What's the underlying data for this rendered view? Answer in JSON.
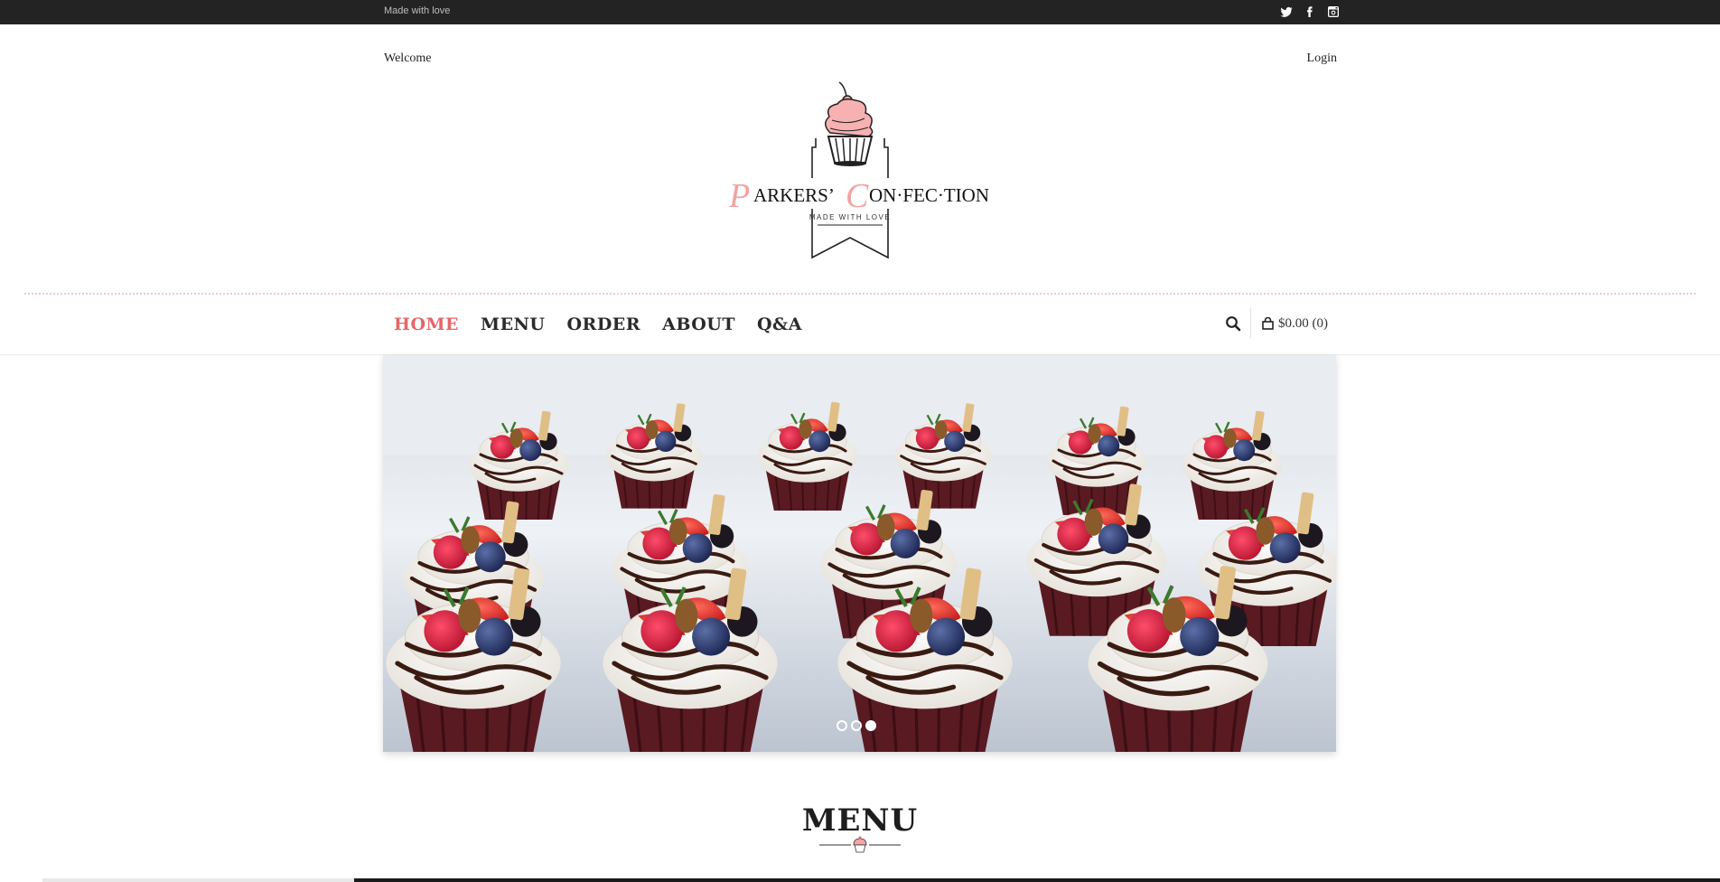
{
  "topbar": {
    "tagline": "Made with love",
    "social": [
      {
        "name": "twitter-icon"
      },
      {
        "name": "facebook-icon"
      },
      {
        "name": "instagram-icon"
      }
    ]
  },
  "header": {
    "welcome": "Welcome",
    "login": "Login",
    "logo": {
      "brand": "PARKERS' CON·FEC·TION",
      "tagline": "MADE WITH LOVE"
    }
  },
  "nav": {
    "items": [
      {
        "label": "HOME",
        "active": true
      },
      {
        "label": "MENU",
        "active": false
      },
      {
        "label": "ORDER",
        "active": false
      },
      {
        "label": "ABOUT",
        "active": false
      },
      {
        "label": "Q&A",
        "active": false
      }
    ],
    "cart_label": "$0.00 (0)"
  },
  "slider": {
    "total_slides": 3,
    "active_slide": 3
  },
  "sections": {
    "menu_heading": "MENU"
  },
  "colors": {
    "accent": "#e46767",
    "topbar": "#232323"
  }
}
